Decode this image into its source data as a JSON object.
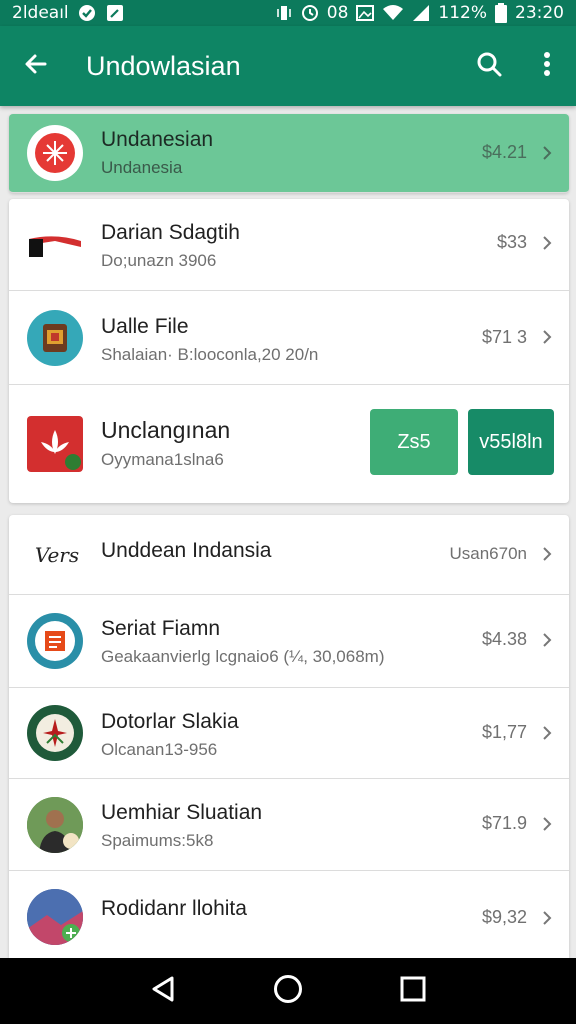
{
  "status": {
    "left_text": "2ldeaıl",
    "right_text_a": "08",
    "battery": "112%",
    "time": "23:20"
  },
  "appbar": {
    "title": "Undowlasian"
  },
  "highlight_row": {
    "title": "Undanesian",
    "subtitle": "Undanesia",
    "price": "$4.21"
  },
  "card1": {
    "rows": [
      {
        "title": "Darian Sdagtih",
        "subtitle": "Do;unazn 3906",
        "price": "$33"
      },
      {
        "title": "Ualle File",
        "subtitle": "Shalaian· B:looconla,20 20/n",
        "price": "$71 3"
      }
    ],
    "action_row": {
      "title": "Unclangınan",
      "subtitle": "Oyymana1slna6",
      "btn1": "Zs5",
      "btn2": "v55l8ln"
    }
  },
  "card2": {
    "rows": [
      {
        "logo_text": "Vers",
        "title": "Unddean Indansia",
        "price": "Usan670n"
      },
      {
        "title": "Seriat Fiamn",
        "subtitle": "Geakaanvierlg lcgnaio6 (¼, 30,068m)",
        "price": "$4.38"
      },
      {
        "title": "Dotorlar Slakia",
        "subtitle": "Olcanan13-956",
        "price": "$1,77"
      },
      {
        "title": "Uemhiar Sluatian",
        "subtitle": "Spaimums:5k8",
        "price": "$71.9"
      },
      {
        "title": "Rodidanr llohita",
        "price": "$9,32"
      }
    ]
  },
  "colors": {
    "primary": "#0e8564",
    "highlight": "#6cc797",
    "button_light": "#3ead76",
    "button_dark": "#178b67"
  }
}
